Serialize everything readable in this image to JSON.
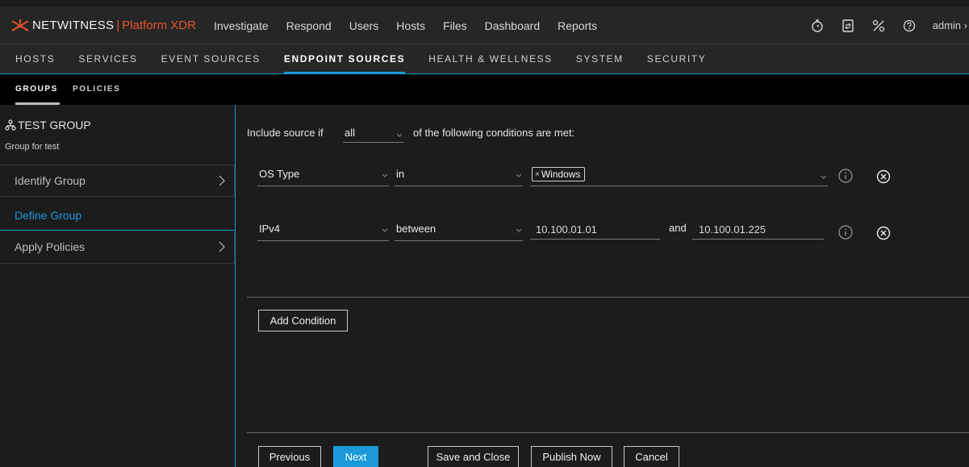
{
  "topbar": {
    "brand": "NETWITNESS",
    "separator": "|",
    "product": "Platform XDR",
    "nav": [
      "Investigate",
      "Respond",
      "Users",
      "Hosts",
      "Files",
      "Dashboard",
      "Reports"
    ],
    "user": "admin",
    "user_chevron": "›"
  },
  "nav2": {
    "items": [
      "HOSTS",
      "SERVICES",
      "EVENT SOURCES",
      "ENDPOINT SOURCES",
      "HEALTH & WELLNESS",
      "SYSTEM",
      "SECURITY"
    ],
    "active": "ENDPOINT SOURCES"
  },
  "tabs": {
    "groups": "GROUPS",
    "policies": "POLICIES"
  },
  "group": {
    "title": "TEST GROUP",
    "description": "Group for test"
  },
  "steps": {
    "identify": "Identify Group",
    "define": "Define Group",
    "apply": "Apply Policies"
  },
  "criteria": {
    "prefix": "Include source if",
    "match": "all",
    "suffix": "of the following conditions are met:",
    "and_label": "and"
  },
  "conditions": [
    {
      "field": "OS Type",
      "operator": "in",
      "values": [
        "Windows"
      ],
      "chip_x": "×"
    },
    {
      "field": "IPv4",
      "operator": "between",
      "value1": "10.100.01.01",
      "value2": "10.100.01.225"
    }
  ],
  "buttons": {
    "add_condition": "Add Condition",
    "previous": "Previous",
    "next": "Next",
    "save_close": "Save and Close",
    "publish": "Publish Now",
    "cancel": "Cancel"
  },
  "colors": {
    "accent": "#1a9ad9",
    "brand_orange": "#e8532c",
    "background": "#1c1c1c"
  }
}
